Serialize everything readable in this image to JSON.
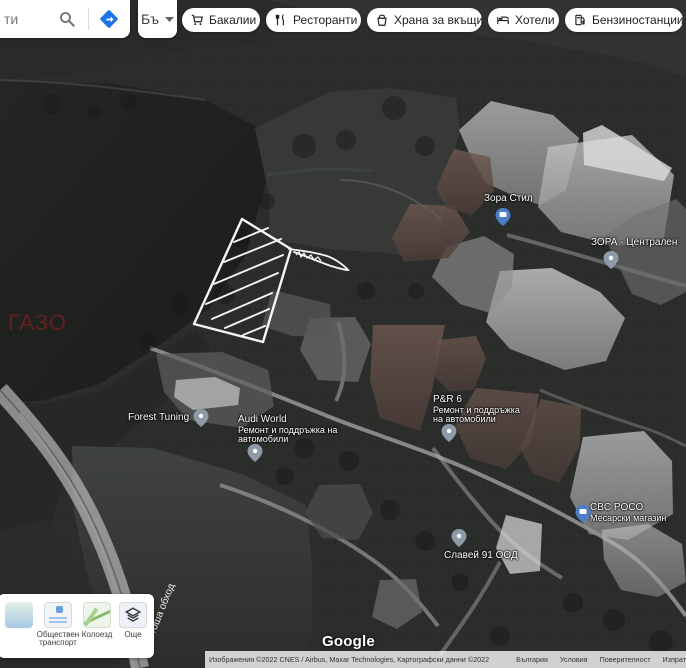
{
  "search": {
    "placeholder": "ти",
    "search_icon": "search-icon",
    "directions_icon": "directions-icon"
  },
  "language_button": {
    "label": "Бъ",
    "icon": "chevron-down-icon"
  },
  "categories": [
    {
      "label": "Бакалии",
      "icon": "cart-icon"
    },
    {
      "label": "Ресторанти",
      "icon": "restaurant-icon"
    },
    {
      "label": "Храна за вкъщи",
      "icon": "takeout-icon"
    },
    {
      "label": "Хотели",
      "icon": "hotel-icon"
    },
    {
      "label": "Бензиностанции",
      "icon": "gas-station-icon"
    }
  ],
  "places": [
    {
      "title": "Зора Стил",
      "subtitle": ""
    },
    {
      "title": "ЗОРА - Централен",
      "subtitle": ""
    },
    {
      "title": "Forest Tuning",
      "subtitle": ""
    },
    {
      "title": "Audi World",
      "subtitle": "Ремонт и поддръжка на автомобили"
    },
    {
      "title": "P&R 6",
      "subtitle": "Ремонт и поддръжка на автомобили"
    },
    {
      "title": "CBC POCO",
      "subtitle": "Месарски магазин"
    },
    {
      "title": "Славей 91 ООД",
      "subtitle": ""
    }
  ],
  "layer_panel": {
    "items": [
      {
        "label": "",
        "icon": "hidden-layer-icon"
      },
      {
        "label": "Обществен транспорт",
        "icon": "transit-layer-icon"
      },
      {
        "label": "Колоезд",
        "icon": "bike-layer-icon"
      },
      {
        "label": "Още",
        "icon": "layers-icon"
      }
    ]
  },
  "brand": "Google",
  "footer": {
    "credit": "Изображения ©2022 CNES / Airbus, Maxar Technologies, Картографски данни ©2022",
    "links": [
      "България",
      "Условия",
      "Поверителност",
      "Изпрат"
    ]
  },
  "map_text": {
    "red_overlay": "ГАЗО",
    "road_label": "Витоша обход"
  },
  "colors": {
    "pin_blue": "#4c7ec8",
    "pin_gray": "#8f9aa8",
    "label_white": "#ffffff",
    "chip_bg": "#ffffff"
  }
}
